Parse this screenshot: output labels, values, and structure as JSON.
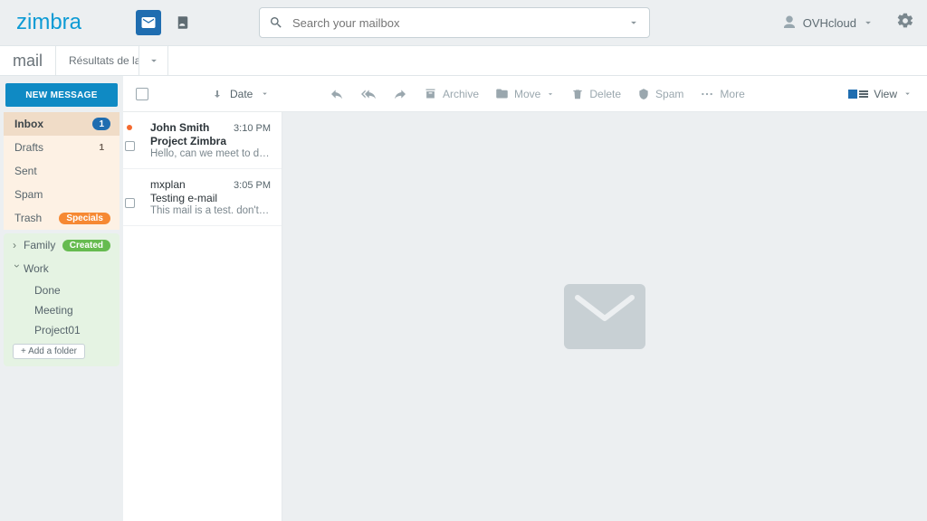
{
  "header": {
    "logo": "zimbra",
    "search_placeholder": "Search your mailbox",
    "user": "OVHcloud"
  },
  "tabs": {
    "main": "mail",
    "second": "Résultats de la …"
  },
  "sidebar": {
    "new_message": "NEW MESSAGE",
    "folders": {
      "inbox": {
        "label": "Inbox",
        "count": "1"
      },
      "drafts": {
        "label": "Drafts",
        "count": "1"
      },
      "sent": {
        "label": "Sent"
      },
      "spam": {
        "label": "Spam"
      },
      "trash": {
        "label": "Trash"
      }
    },
    "badges": {
      "specials": "Specials",
      "created": "Created"
    },
    "tree": {
      "family": "Family",
      "work": "Work",
      "work_children": [
        "Done",
        "Meeting",
        "Project01"
      ]
    },
    "add_folder": "+ Add a folder"
  },
  "list_toolbar": {
    "sort_by": "Date",
    "actions": {
      "archive": "Archive",
      "move": "Move",
      "delete": "Delete",
      "spam": "Spam",
      "more": "More"
    },
    "view": "View"
  },
  "messages": [
    {
      "from": "John Smith",
      "time": "3:10 PM",
      "subject": "Project Zimbra",
      "preview": "Hello, can we meet to discus…",
      "unread": true
    },
    {
      "from": "mxplan",
      "time": "3:05 PM",
      "subject": "Testing e-mail",
      "preview": "This mail is a test. don't reply",
      "unread": false
    }
  ]
}
